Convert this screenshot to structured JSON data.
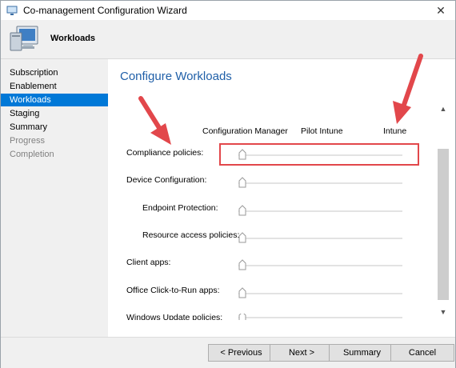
{
  "window": {
    "title": "Co-management Configuration Wizard",
    "close_glyph": "✕"
  },
  "header": {
    "page_label": "Workloads"
  },
  "nav": {
    "items": [
      {
        "label": "Subscription",
        "state": "normal"
      },
      {
        "label": "Enablement",
        "state": "normal"
      },
      {
        "label": "Workloads",
        "state": "active"
      },
      {
        "label": "Staging",
        "state": "normal"
      },
      {
        "label": "Summary",
        "state": "normal"
      },
      {
        "label": "Progress",
        "state": "disabled"
      },
      {
        "label": "Completion",
        "state": "disabled"
      }
    ]
  },
  "main": {
    "title": "Configure Workloads",
    "columns": [
      "Configuration Manager",
      "Pilot Intune",
      "Intune"
    ],
    "workloads": [
      {
        "label": "Compliance policies:",
        "setting": "Configuration Manager"
      },
      {
        "label": "Device Configuration:",
        "setting": "Configuration Manager"
      },
      {
        "label": "Endpoint Protection:",
        "setting": "Configuration Manager"
      },
      {
        "label": "Resource access policies:",
        "setting": "Configuration Manager"
      },
      {
        "label": "Client apps:",
        "setting": "Configuration Manager"
      },
      {
        "label": "Office Click-to-Run apps:",
        "setting": "Configuration Manager"
      },
      {
        "label": "Windows Update policies:",
        "setting": "Configuration Manager"
      }
    ]
  },
  "footer": {
    "previous_label": "< Previous",
    "next_label": "Next >",
    "summary_label": "Summary",
    "cancel_label": "Cancel"
  },
  "colors": {
    "accent": "#0078d7",
    "title_blue": "#1f5fa8",
    "annotation_red": "#e2474b"
  }
}
